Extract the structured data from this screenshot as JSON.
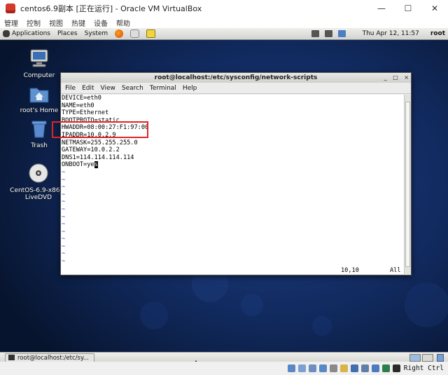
{
  "vbox": {
    "title": "centos6.9副本 [正在运行] - Oracle VM VirtualBox",
    "menu": [
      "管理",
      "控制",
      "视图",
      "热键",
      "设备",
      "帮助"
    ],
    "controls": {
      "minimize": "—",
      "maximize": "☐",
      "close": "✕"
    },
    "host_key": "Right Ctrl"
  },
  "gnome": {
    "menu": [
      "Applications",
      "Places",
      "System"
    ],
    "clock": "Thu Apr 12, 11:57",
    "user": "root"
  },
  "desktop_icons": [
    {
      "label": "Computer"
    },
    {
      "label": "root's Home"
    },
    {
      "label": "Trash"
    },
    {
      "label": "CentOS-6.9-x86_6",
      "label2": "LiveDVD"
    }
  ],
  "terminal": {
    "title": "root@localhost:/etc/sysconfig/network-scripts",
    "menu": [
      "File",
      "Edit",
      "View",
      "Search",
      "Terminal",
      "Help"
    ],
    "lines": [
      "DEVICE=eth0",
      "NAME=eth0",
      "TYPE=Ethernet",
      "BOOTPROTO=static",
      "HWADDR=08:00:27:F1:97:00",
      "IPADDR=10.0.2.9",
      "NETMASK=255.255.255.0",
      "GATEWAY=10.0.2.2",
      "DNS1=114.114.114.114",
      "ONBOOT=ye"
    ],
    "cursor_char": "s",
    "tilde": "~",
    "status_pos": "10,10",
    "status_all": "All"
  },
  "taskbar": {
    "task_label": "root@localhost:/etc/sy..."
  },
  "colors": {
    "highlight": "#e02424",
    "vim_tilde": "#2b2bd6"
  }
}
